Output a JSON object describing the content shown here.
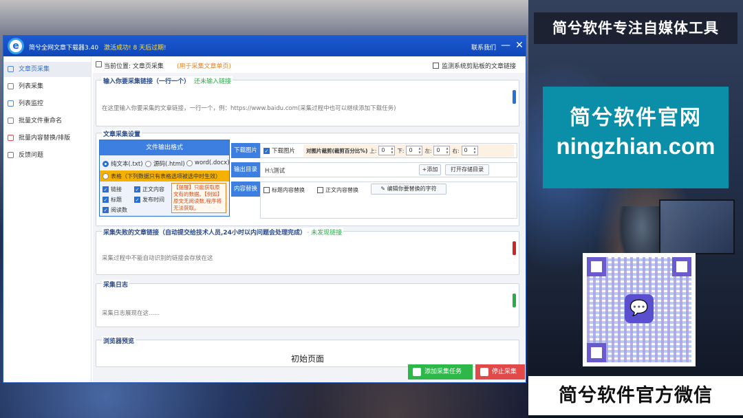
{
  "window": {
    "title": "简兮全网文章下载器3.40",
    "activation": "激活成功! 8 天后过期!",
    "contact": "联系我们",
    "minimize": "—",
    "close": "✕"
  },
  "sidebar": {
    "items": [
      {
        "label": "文章页采集",
        "active": true
      },
      {
        "label": "列表采集"
      },
      {
        "label": "列表监控"
      },
      {
        "label": "批量文件重命名"
      },
      {
        "label": "批量内容替换/排版"
      },
      {
        "label": "反馈问题"
      }
    ]
  },
  "location": {
    "label": "当前位置: 文章页采集",
    "hint": "(用于采集文章单页)",
    "monitor": "监测系统剪贴板的文章链接"
  },
  "input_group": {
    "title": "输入你要采集链接（一行一个）",
    "status": "还未输入链接",
    "placeholder": "在这里输入你要采集的文章链接，一行一个，例：https://www.baidu.com(采集过程中也可以继续添加下载任务)"
  },
  "settings": {
    "title": "文章采集设置",
    "format_head": "文件输出格式",
    "formats": [
      "纯文本(.txt)",
      "源码(.html)",
      "word(.docx)"
    ],
    "table_option": "表格（下列数据只有表格选项被选中时生效）",
    "fields": [
      "链接",
      "正文内容",
      "标题",
      "发布时间",
      "阅读数"
    ],
    "tip": "【提醒】只能获取原文有的数据。【例如】原文无阅读数,程序将无法获取。",
    "download_label": "下载图片",
    "download_check": "下载图片",
    "crop_label": "对图片裁剪(裁剪百分比%)",
    "crop": [
      {
        "label": "上:",
        "value": "0"
      },
      {
        "label": "下:",
        "value": "0"
      },
      {
        "label": "左:",
        "value": "0"
      },
      {
        "label": "右:",
        "value": "0"
      }
    ],
    "output_label": "输出目录",
    "output_value": "H:\\测试",
    "add_btn": "+添加",
    "open_btn": "打开存储目录",
    "replace_label": "内容替换",
    "replace_title": "标题内容替换",
    "replace_body": "正文内容替换",
    "edit_btn": "编辑你要替换的字符"
  },
  "failed": {
    "title": "采集失败的文章链接（自动提交给技术人员,24小时以内问题会处理完成）",
    "status": "· 未发现链接",
    "placeholder": "采集过程中不能自动识别的链接会存放在这"
  },
  "log": {
    "title": "采集日志",
    "placeholder": "采集日志展现在这......"
  },
  "preview": {
    "title": "浏览器预览",
    "page": "初始页面"
  },
  "actions": {
    "add": "添加采集任务",
    "stop": "停止采集"
  },
  "promo": {
    "title": "简兮软件专注自媒体工具",
    "name": "简兮软件官网",
    "domain": "ningzhian.com",
    "bottom": "简兮软件官方微信",
    "qr_icon": "wechat-icon"
  },
  "colors": {
    "accent": "#2a6fd4",
    "green": "#2daa4a",
    "red": "#e24a4a",
    "orange": "#f5b100"
  }
}
